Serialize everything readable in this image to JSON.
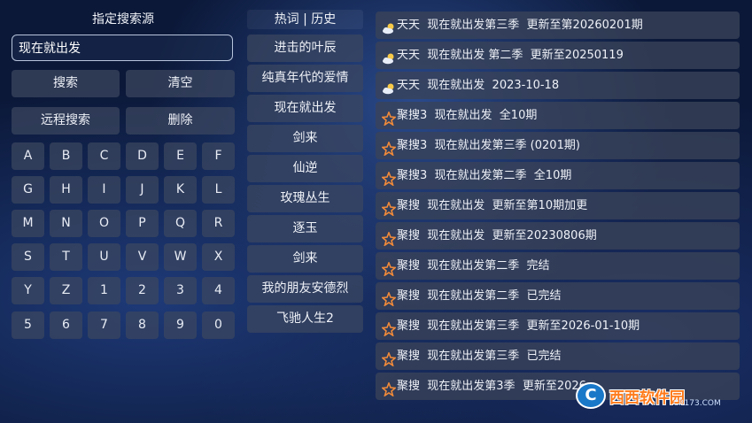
{
  "left_panel": {
    "title": "指定搜索源",
    "search_value": "现在就出发",
    "buttons": {
      "search": "搜索",
      "clear": "清空",
      "remote_search": "远程搜索",
      "delete": "删除"
    },
    "keys": [
      "A",
      "B",
      "C",
      "D",
      "E",
      "F",
      "G",
      "H",
      "I",
      "J",
      "K",
      "L",
      "M",
      "N",
      "O",
      "P",
      "Q",
      "R",
      "S",
      "T",
      "U",
      "V",
      "W",
      "X",
      "Y",
      "Z",
      "1",
      "2",
      "3",
      "4",
      "5",
      "6",
      "7",
      "8",
      "9",
      "0"
    ]
  },
  "middle_panel": {
    "title": "热词 | 历史",
    "items": [
      "进击的叶辰",
      "纯真年代的爱情",
      "现在就出发",
      "剑来",
      "仙逆",
      "玫瑰丛生",
      "逐玉",
      "剑来",
      "我的朋友安德烈",
      "飞驰人生2"
    ]
  },
  "results": [
    {
      "icon": "weather-icon",
      "source": "天天",
      "title": "现在就出发第三季  更新至第20260201期"
    },
    {
      "icon": "weather-icon",
      "source": "天天",
      "title": "现在就出发 第二季  更新至20250119"
    },
    {
      "icon": "weather-icon",
      "source": "天天",
      "title": "现在就出发  2023-10-18"
    },
    {
      "icon": "star-icon",
      "source": "聚搜3",
      "title": "现在就出发  全10期"
    },
    {
      "icon": "star-icon",
      "source": "聚搜3",
      "title": "现在就出发第三季 (0201期)"
    },
    {
      "icon": "star-icon",
      "source": "聚搜3",
      "title": "现在就出发第二季  全10期"
    },
    {
      "icon": "star-icon",
      "source": "聚搜",
      "title": "现在就出发  更新至第10期加更"
    },
    {
      "icon": "star-icon",
      "source": "聚搜",
      "title": "现在就出发  更新至20230806期"
    },
    {
      "icon": "star-icon",
      "source": "聚搜",
      "title": "现在就出发第二季  完结"
    },
    {
      "icon": "star-icon",
      "source": "聚搜",
      "title": "现在就出发第二季  已完结"
    },
    {
      "icon": "star-icon",
      "source": "聚搜",
      "title": "现在就出发第三季  更新至2026-01-10期"
    },
    {
      "icon": "star-icon",
      "source": "聚搜",
      "title": "现在就出发第三季  已完结"
    },
    {
      "icon": "star-icon",
      "source": "聚搜",
      "title": "现在就出发第3季  更新至2026"
    }
  ],
  "watermark": {
    "logo": "C",
    "name": "西西软件园",
    "url": "CR173.COM"
  }
}
